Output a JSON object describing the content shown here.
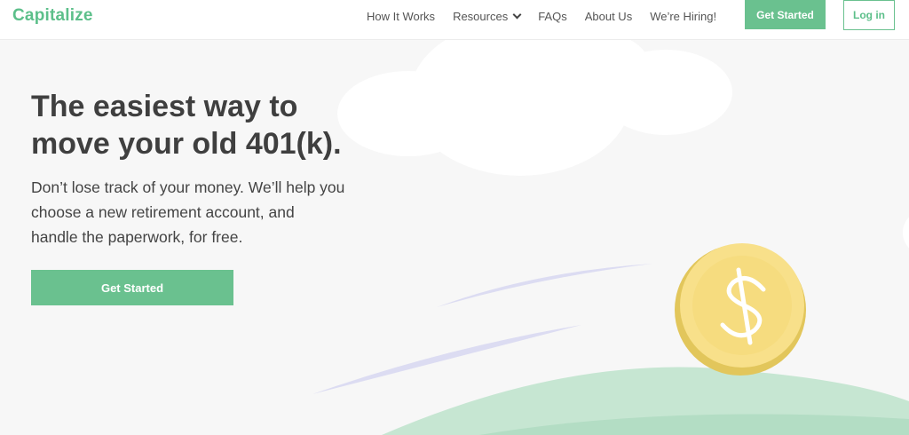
{
  "brand": {
    "name": "Capitalize",
    "accent": "#6ac18f"
  },
  "nav": {
    "items": [
      {
        "label": "How It Works"
      },
      {
        "label": "Resources",
        "icon": "chevron-down-icon"
      },
      {
        "label": "FAQs"
      },
      {
        "label": "About Us"
      },
      {
        "label": "We’re Hiring!"
      }
    ],
    "get_started_label": "Get Started",
    "login_label": "Log in"
  },
  "hero": {
    "title_lines": [
      "The easiest way to",
      "move your old 401(k)."
    ],
    "subtitle_lines": [
      "Don’t lose track of your money. We’ll help you",
      "choose a new retirement account, and",
      "handle the paperwork, for free."
    ],
    "cta_label": "Get Started"
  },
  "illustration": {
    "coin_symbol": "$",
    "coin_color": "#f8e08a",
    "hill_color": "#c6e6d2",
    "streak_color": "#dcdcf2",
    "cloud_color": "#ffffff"
  }
}
